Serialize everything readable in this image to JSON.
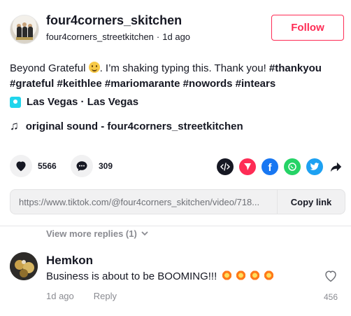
{
  "header": {
    "username": "four4corners_skitchen",
    "handle": "four4corners_streetkitchen",
    "separator": "·",
    "time_ago": "1d ago",
    "follow_label": "Follow"
  },
  "caption": {
    "text_before": "Beyond Grateful ",
    "text_after": ". I’m shaking typing this. Thank you! ",
    "hashtags": [
      "#thankyou",
      "#grateful",
      "#keithlee",
      "#mariomarante",
      "#nowords",
      "#intears"
    ]
  },
  "location": {
    "label": "Las Vegas · Las Vegas",
    "icon": "location-pin-icon"
  },
  "music": {
    "label": "original sound - four4corners_streetkitchen",
    "icon": "music-note-icon"
  },
  "stats": {
    "likes": "5566",
    "comments": "309"
  },
  "share": {
    "icons": [
      "embed-icon",
      "send-icon",
      "facebook-icon",
      "whatsapp-icon",
      "twitter-icon",
      "share-arrow-icon"
    ],
    "colors": {
      "send": "#fe2c55",
      "facebook": "#1877f2",
      "whatsapp": "#25d366",
      "twitter": "#1da1f2",
      "embed": "#161823"
    }
  },
  "link": {
    "url": "https://www.tiktok.com/@four4corners_skitchen/video/718...",
    "copy_label": "Copy link"
  },
  "replies": {
    "view_more_label": "View more replies (1)"
  },
  "comment": {
    "author": "Hemkon",
    "text": "Business is about to be BOOMING!!!",
    "time_ago": "1d ago",
    "reply_label": "Reply",
    "like_count": "456"
  },
  "colors": {
    "accent": "#fe2c55",
    "text": "#161823",
    "muted": "#8a8b91"
  }
}
